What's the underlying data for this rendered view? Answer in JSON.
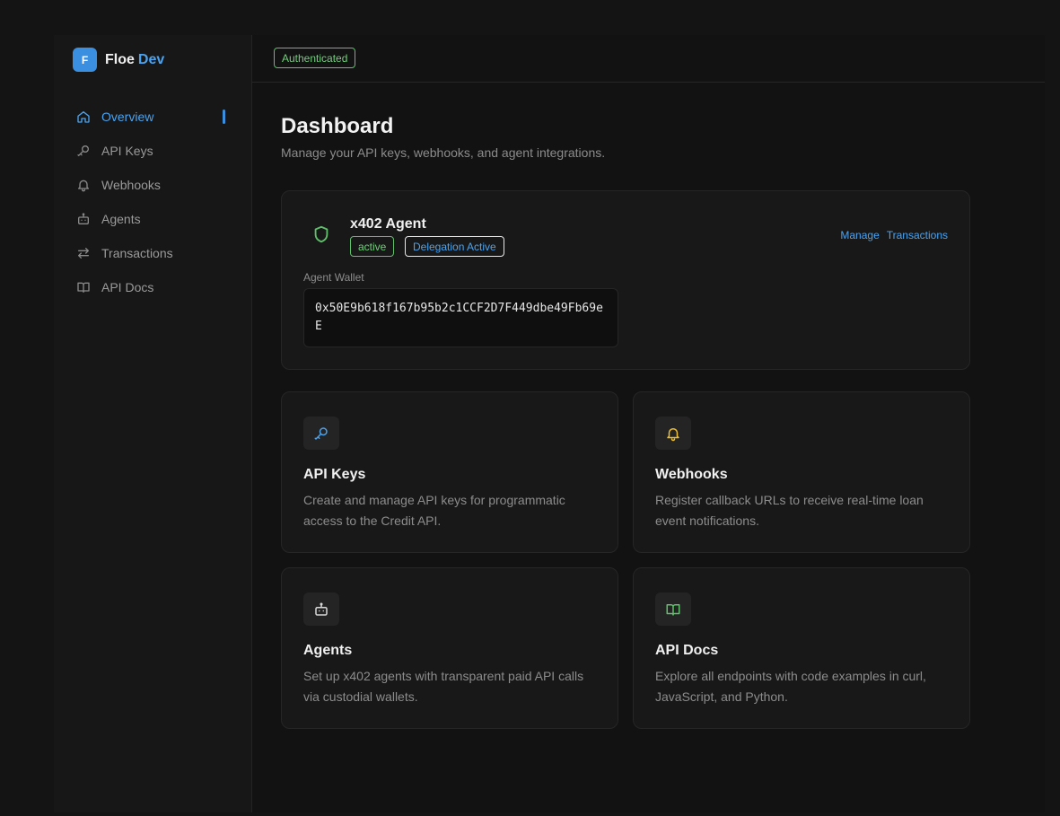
{
  "brand": {
    "logo_letter": "F",
    "name": "Floe",
    "accent": "Dev"
  },
  "nav": {
    "items": [
      {
        "label": "Overview",
        "icon": "home-icon",
        "active": true
      },
      {
        "label": "API Keys",
        "icon": "key-icon",
        "active": false
      },
      {
        "label": "Webhooks",
        "icon": "bell-icon",
        "active": false
      },
      {
        "label": "Agents",
        "icon": "robot-icon",
        "active": false
      },
      {
        "label": "Transactions",
        "icon": "arrows-swap-icon",
        "active": false
      },
      {
        "label": "API Docs",
        "icon": "book-icon",
        "active": false
      }
    ]
  },
  "topbar": {
    "status": "Authenticated"
  },
  "page": {
    "title": "Dashboard",
    "subtitle": "Manage your API keys, webhooks, and agent integrations."
  },
  "agent": {
    "icon": "shield-icon",
    "title": "x402 Agent",
    "status": "active",
    "delegation": "Delegation Active",
    "links": {
      "manage": "Manage",
      "transactions": "Transactions"
    },
    "wallet_label": "Agent Wallet",
    "wallet_address": "0x50E9b618f167b95b2c1CCF2D7F449dbe49Fb69eE"
  },
  "features": [
    {
      "icon": "key-icon",
      "title": "API Keys",
      "description": "Create and manage API keys for programmatic access to the Credit API."
    },
    {
      "icon": "bell-icon",
      "title": "Webhooks",
      "description": "Register callback URLs to receive real-time loan event notifications."
    },
    {
      "icon": "robot-icon",
      "title": "Agents",
      "description": "Set up x402 agents with transparent paid API calls via custodial wallets."
    },
    {
      "icon": "book-icon",
      "title": "API Docs",
      "description": "Explore all endpoints with code examples in curl, JavaScript, and Python."
    }
  ],
  "colors": {
    "accent": "#4aa3f0",
    "success": "#6fd07a",
    "warning": "#f0c030",
    "background": "#121212"
  }
}
